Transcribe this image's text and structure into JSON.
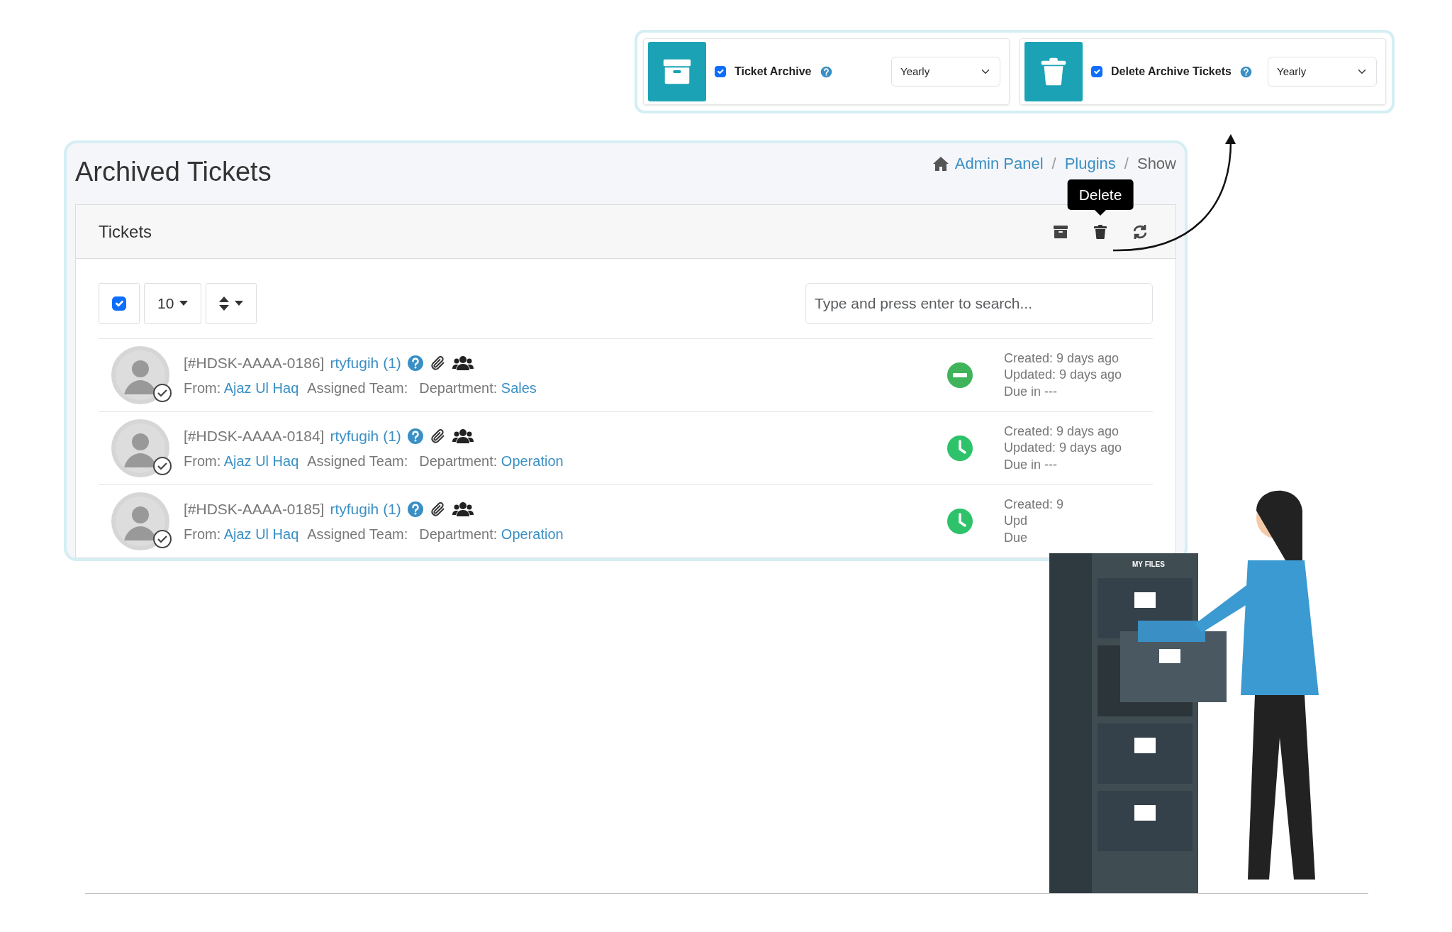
{
  "settings": [
    {
      "kind": "archive",
      "label": "Ticket Archive",
      "checked": true,
      "frequency": "Yearly"
    },
    {
      "kind": "trash",
      "label": "Delete Archive Tickets",
      "checked": true,
      "frequency": "Yearly"
    }
  ],
  "page": {
    "title": "Archived Tickets",
    "separator": "/",
    "breadcrumb": [
      {
        "label": "Admin Panel",
        "link": true
      },
      {
        "label": "Plugins",
        "link": true
      },
      {
        "label": "Show",
        "link": false
      }
    ]
  },
  "card": {
    "title": "Tickets",
    "tooltip": "Delete",
    "select_all_checked": true,
    "page_size": "10",
    "search": {
      "placeholder": "Type and press enter to search..."
    }
  },
  "tickets": [
    {
      "id": "[#HDSK-AAAA-0186]",
      "subject": "rtyfugih (1)",
      "from_label": "From:",
      "from": "Ajaz Ul Haq",
      "team_label": "Assigned Team:",
      "department_label": "Department:",
      "department": "Sales",
      "kind": "blocked",
      "meta": [
        "Created: 9 days ago",
        "Updated: 9 days ago",
        "Due in ---"
      ]
    },
    {
      "id": "[#HDSK-AAAA-0184]",
      "subject": "rtyfugih (1)",
      "from_label": "From:",
      "from": "Ajaz Ul Haq",
      "team_label": "Assigned Team:",
      "department_label": "Department:",
      "department": "Operation",
      "kind": "pending",
      "meta": [
        "Created: 9 days ago",
        "Updated: 9 days ago",
        "Due in ---"
      ]
    },
    {
      "id": "[#HDSK-AAAA-0185]",
      "subject": "rtyfugih (1)",
      "from_label": "From:",
      "from": "Ajaz Ul Haq",
      "team_label": "Assigned Team:",
      "department_label": "Department:",
      "department": "Operation",
      "kind": "pending",
      "meta": [
        "Created: 9",
        "Upd",
        "Due"
      ]
    }
  ],
  "illustration": {
    "cabinet_label": "MY FILES"
  }
}
